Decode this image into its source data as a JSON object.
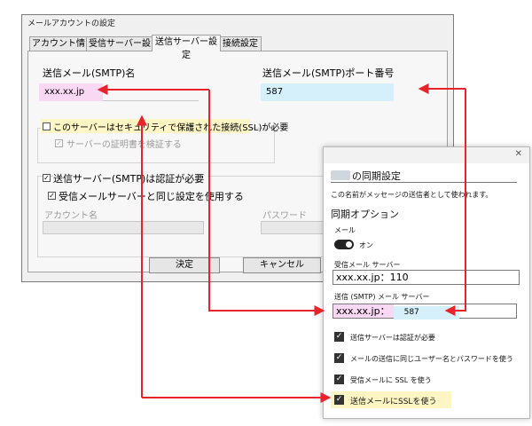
{
  "dialog": {
    "title": "メールアカウントの設定",
    "tabs": [
      "アカウント情報",
      "受信サーバー設定",
      "送信サーバー設定",
      "接続設定"
    ],
    "active_tab": 2,
    "smtp_name_label": "送信メール(SMTP)名",
    "smtp_name_value": "xxx.xx.jp",
    "smtp_port_label": "送信メール(SMTP)ポート番号",
    "smtp_port_value": "587",
    "ssl_checkbox_label": "このサーバーはセキュリティで保護された接続(SSL)が必要",
    "ssl_checked": false,
    "verify_cert_label": "サーバーの証明書を検証する",
    "auth_checkbox_label": "送信サーバー(SMTP)は認証が必要",
    "auth_checked": true,
    "same_as_incoming_label": "受信メールサーバーと同じ設定を使用する",
    "same_as_incoming_checked": true,
    "account_name_label": "アカウント名",
    "password_label": "パスワード",
    "ok_button": "決定",
    "cancel_button": "キャンセル"
  },
  "sync_panel": {
    "close_glyph": "✕",
    "title_suffix": "の同期設定",
    "name_note": "この名前がメッセージの送信者として使われます。",
    "sync_options_heading": "同期オプション",
    "mail_label": "メール",
    "mail_toggle_state": "オン",
    "incoming_server_label": "受信メール サーバー",
    "incoming_server_value": "xxx.xx.jp：110",
    "outgoing_server_label": "送信 (SMTP) メール サーバー",
    "outgoing_server_host": "xxx.xx.jp：",
    "outgoing_server_port": "587",
    "checkboxes": [
      {
        "label": "送信サーバーは認証が必要",
        "checked": true
      },
      {
        "label": "メールの送信に同じユーザー名とパスワードを使う",
        "checked": true
      },
      {
        "label": "受信メールに SSL を使う",
        "checked": true
      },
      {
        "label": "送信メールにSSLを使う",
        "checked": true
      }
    ]
  },
  "colors": {
    "arrow": "#e8232b",
    "highlight_pink": "#f8d8f2",
    "highlight_yellow": "#fdf6c4",
    "highlight_blue": "#d6f0fb"
  },
  "icons": {
    "checkmark": "check-icon",
    "close": "close-icon",
    "toggle": "toggle-switch-icon",
    "arrow": "arrow-icon"
  }
}
